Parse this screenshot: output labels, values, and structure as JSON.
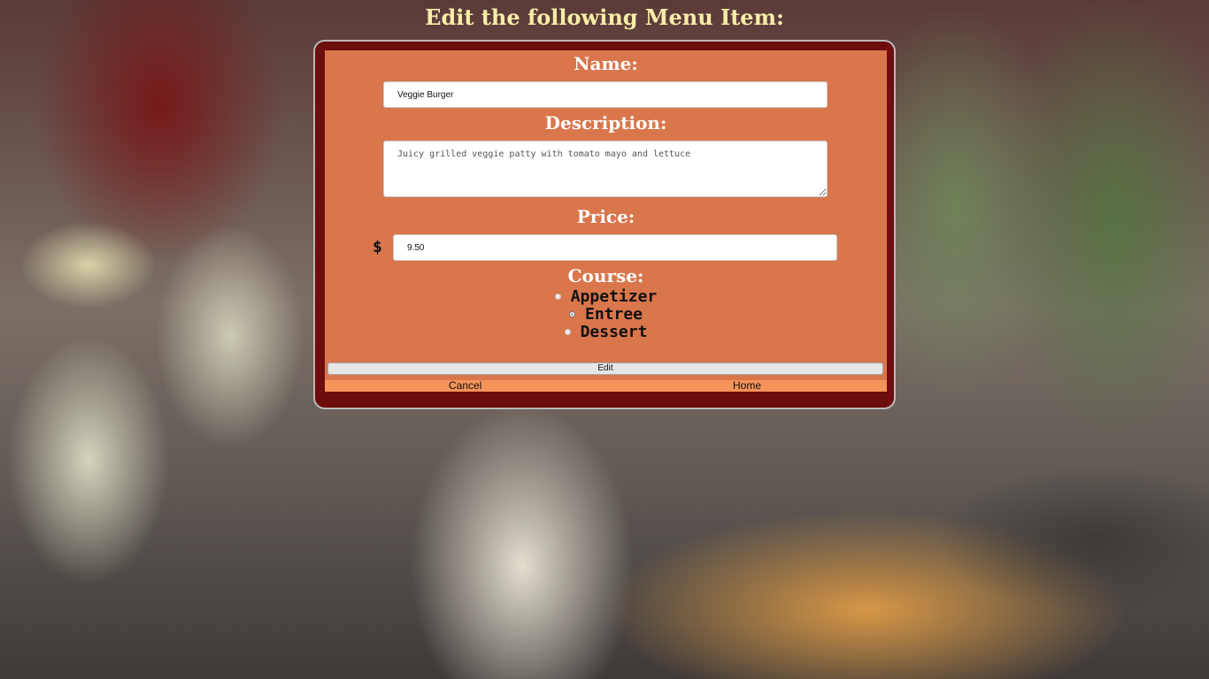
{
  "page": {
    "title": "Edit the following Menu Item:"
  },
  "form": {
    "name_label": "Name:",
    "name_value": "Veggie Burger",
    "description_label": "Description:",
    "description_value": "Juicy grilled veggie patty with tomato mayo and lettuce",
    "price_label": "Price:",
    "currency_symbol": "$",
    "price_value": "9.50",
    "course_label": "Course:",
    "course_options": [
      {
        "label": "Appetizer",
        "selected": false
      },
      {
        "label": "Entree",
        "selected": true
      },
      {
        "label": "Dessert",
        "selected": false
      }
    ],
    "submit_label": "Edit"
  },
  "nav": {
    "cancel_label": "Cancel",
    "home_label": "Home"
  },
  "colors": {
    "title": "#f6eda7",
    "panel_border": "#6e0d0d",
    "form_background": "#d9764c",
    "nav_background": "#f4935a"
  }
}
